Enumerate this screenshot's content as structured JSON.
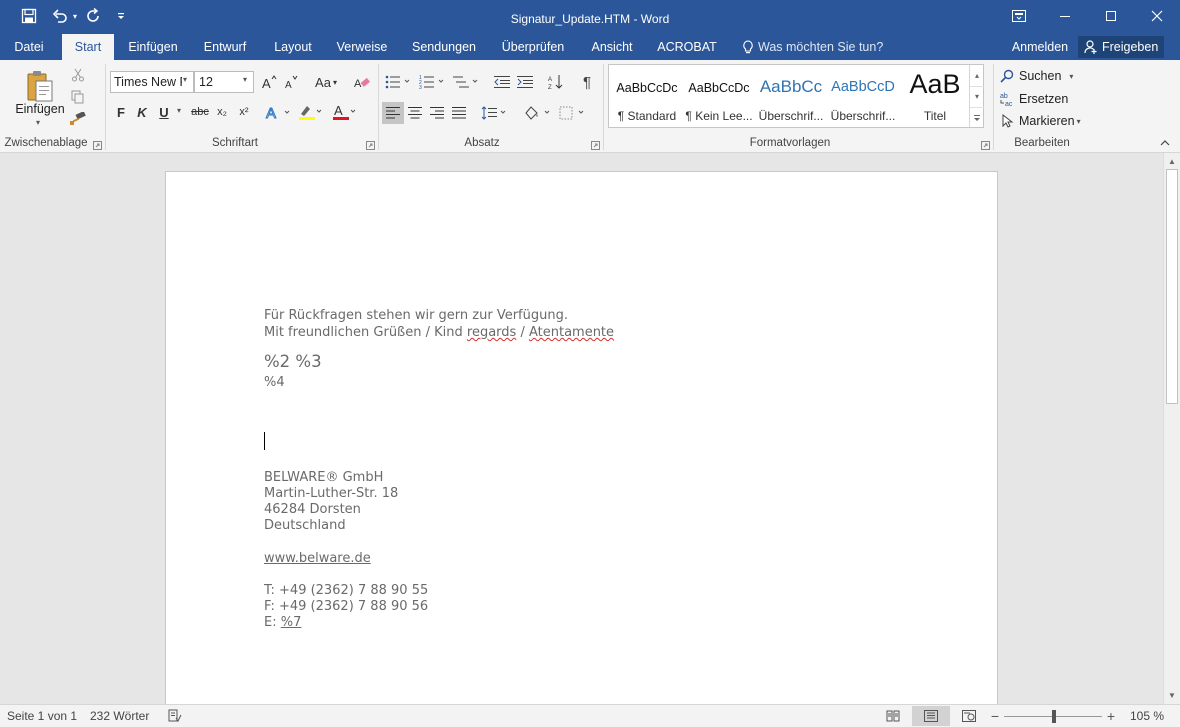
{
  "title_bar": {
    "title": "Signatur_Update.HTM - Word"
  },
  "tabs": {
    "file": "Datei",
    "home": "Start",
    "insert": "Einfügen",
    "design": "Entwurf",
    "layout": "Layout",
    "references": "Verweise",
    "mailings": "Sendungen",
    "review": "Überprüfen",
    "view": "Ansicht",
    "acrobat": "ACROBAT",
    "tell_me": "Was möchten Sie tun?",
    "sign_in": "Anmelden",
    "share": "Freigeben"
  },
  "ribbon": {
    "clipboard": {
      "paste_label": "Einfügen",
      "group_label": "Zwischenablage"
    },
    "font": {
      "font_name": "Times New R",
      "font_size": "12",
      "change_case": "Aa",
      "bold": "F",
      "italic": "K",
      "underline": "U",
      "strikethrough": "abc",
      "subscript": "x₂",
      "superscript": "x²",
      "group_label": "Schriftart"
    },
    "paragraph": {
      "group_label": "Absatz"
    },
    "styles": {
      "items": [
        {
          "sample": "AaBbCcDc",
          "name": "¶ Standard"
        },
        {
          "sample": "AaBbCcDc",
          "name": "¶ Kein Lee..."
        },
        {
          "sample": "AaBbCc",
          "name": "Überschrif..."
        },
        {
          "sample": "AaBbCcD",
          "name": "Überschrif..."
        },
        {
          "sample": "AaB",
          "name": "Titel"
        }
      ],
      "group_label": "Formatvorlagen"
    },
    "editing": {
      "find": "Suchen",
      "replace": "Ersetzen",
      "select": "Markieren",
      "group_label": "Bearbeiten"
    }
  },
  "document": {
    "line1": "Für Rückfragen stehen wir gern zur Verfügung.",
    "line2_a": "Mit freundlichen Grüßen / Kind ",
    "line2_b": "regards",
    "line2_c": " / ",
    "line2_d": "Atentamente",
    "placeholder_name": "%2 %3",
    "placeholder_title": "%4",
    "company": "BELWARE® GmbH",
    "street": "Martin-Luther-Str. 18",
    "city": "46284 Dorsten",
    "country": "Deutschland",
    "website": "www.belware.de",
    "phone": "T: +49 (2362) 7 88 90 55",
    "fax": "F: +49 (2362) 7 88 90 56",
    "email_label": "E: ",
    "email_value": "%7"
  },
  "status_bar": {
    "page": "Seite 1 von 1",
    "words": "232 Wörter",
    "zoom": "105 %"
  },
  "colors": {
    "brand_blue": "#2b579a",
    "ribbon_bg": "#f4f4f4"
  },
  "icons": [
    "save-icon",
    "undo-icon",
    "redo-icon",
    "customize-qat-icon",
    "ribbon-display-icon",
    "minimize-icon",
    "maximize-icon",
    "close-icon",
    "lightbulb-icon",
    "person-icon",
    "paste-icon",
    "cut-icon",
    "copy-icon",
    "format-painter-icon",
    "search-icon",
    "replace-icon",
    "select-icon"
  ]
}
